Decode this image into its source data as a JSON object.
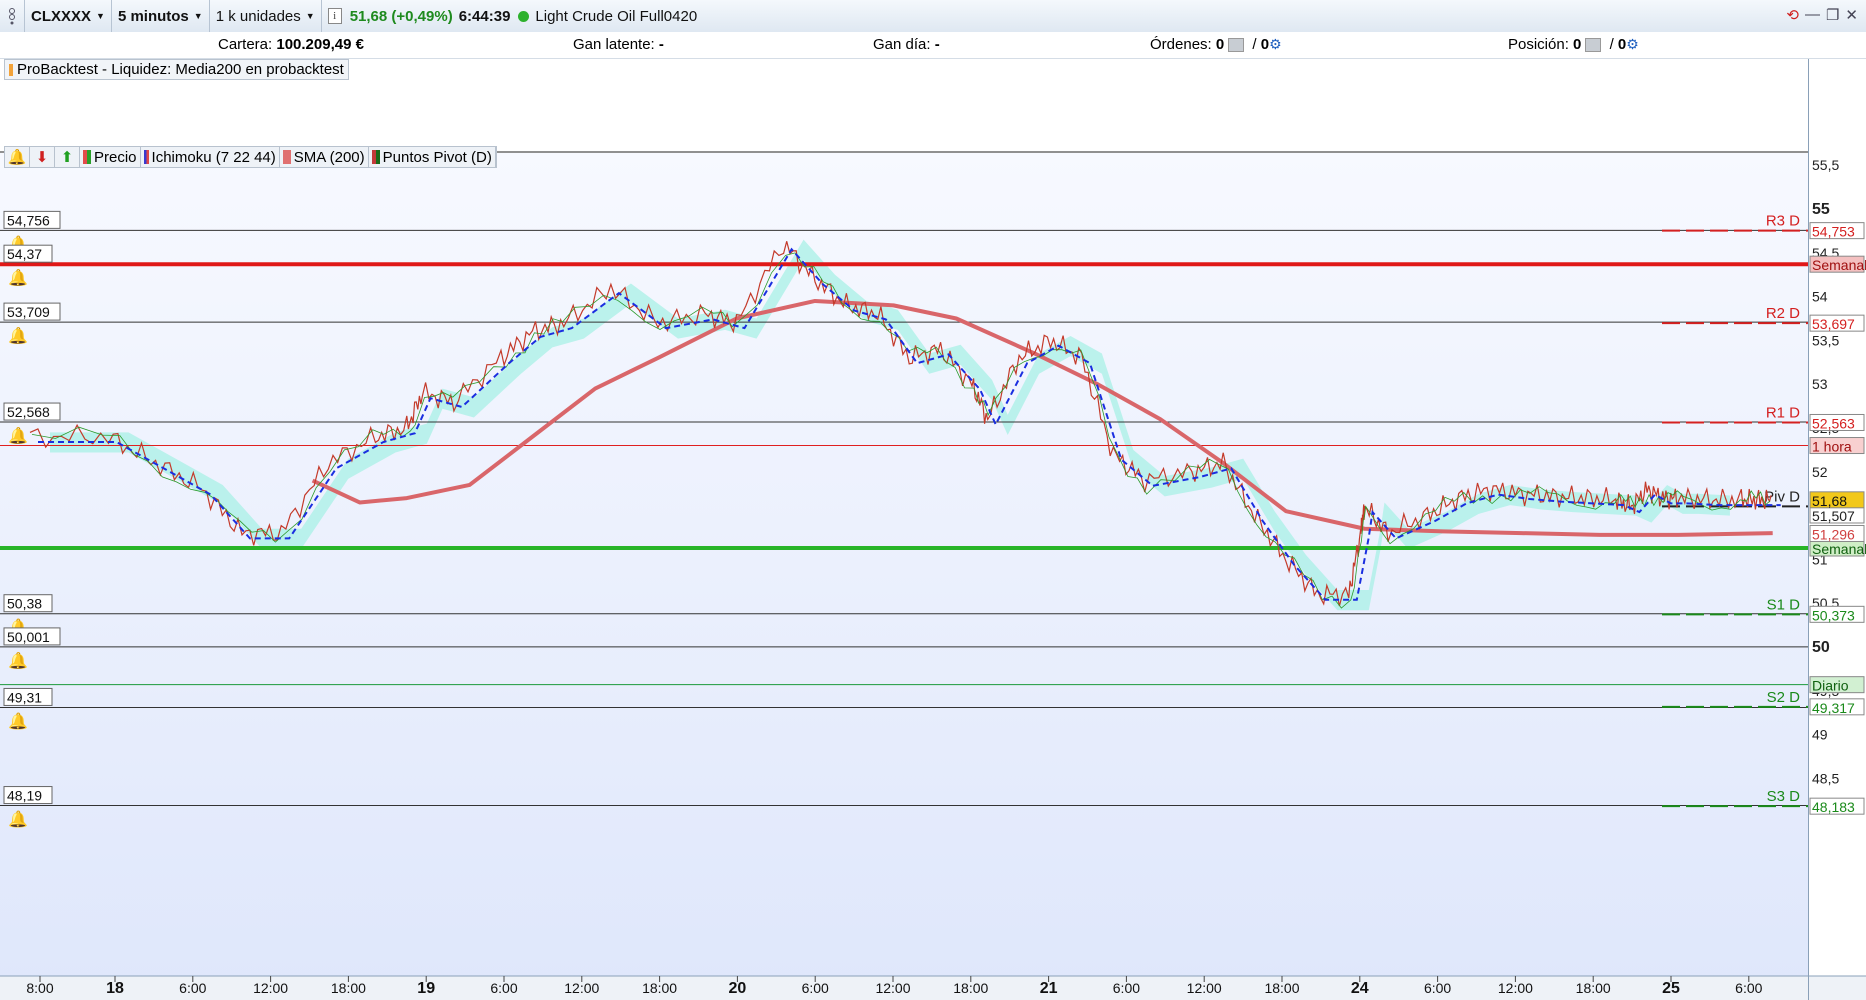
{
  "toolbar": {
    "symbol": "CLXXXX",
    "timeframe": "5 minutos",
    "units": "1 k unidades",
    "info_icon": "i",
    "price_change": "51,68 (+0,49%)",
    "time": "6:44:39",
    "instrument": "Light Crude Oil Full0420",
    "window_controls": [
      "refresh-icon",
      "minimize-icon",
      "restore-icon",
      "close-icon"
    ]
  },
  "portfolio": {
    "cartera_label": "Cartera:",
    "cartera_value": "100.209,49 €",
    "gan_latente_label": "Gan latente:",
    "gan_latente_value": "-",
    "gan_dia_label": "Gan día:",
    "gan_dia_value": "-",
    "ordenes_label": "Órdenes:",
    "ordenes_value_1": "0",
    "ordenes_sep": "/",
    "ordenes_value_2": "0",
    "posicion_label": "Posición:",
    "posicion_value_1": "0",
    "posicion_value_2": "0"
  },
  "backtest_label": "ProBacktest - Liquidez: Media200 en probacktest",
  "legend": {
    "items": [
      "Precio",
      "Ichimoku (7 22 44)",
      "SMA (200)",
      "Puntos Pivot (D)"
    ],
    "colors": [
      "#e34b4b",
      "#3a3ad0",
      "#e07070",
      "#c33a3a"
    ]
  },
  "colors": {
    "sma": "#d9666a",
    "kijun": "#1a2ee0",
    "cloud_bull": "#a8f0e6",
    "cloud_bear": "#a8f0b8",
    "weekly_high": "#e01818",
    "weekly_low": "#28b428",
    "pivot_r": "#d42020",
    "pivot_s": "#1a8a1a",
    "hourly": "#e02020",
    "daily": "#1a9a3a",
    "last_price_bg": "#f2c81a"
  },
  "chart_data": {
    "type": "line",
    "title": "",
    "xlabel": "",
    "ylabel": "",
    "ylim": [
      48.1,
      56.0
    ],
    "grid": false,
    "x_ticks": [
      "8:00",
      "18",
      "6:00",
      "12:00",
      "18:00",
      "19",
      "6:00",
      "12:00",
      "18:00",
      "20",
      "6:00",
      "12:00",
      "18:00",
      "21",
      "6:00",
      "12:00",
      "18:00",
      "24",
      "6:00",
      "12:00",
      "18:00",
      "25",
      "6:00"
    ],
    "x_ticks_bold": [
      "18",
      "19",
      "20",
      "21",
      "24",
      "25"
    ],
    "y_ticks": [
      "55,5",
      "55",
      "54,5",
      "54",
      "53,5",
      "53",
      "52,5",
      "52",
      "51,5",
      "51",
      "50,5",
      "50",
      "49,5",
      "49",
      "48,5"
    ],
    "y_ticks_values": [
      55.5,
      55,
      54.5,
      54,
      53.5,
      53,
      52.5,
      52,
      51.5,
      51,
      50.5,
      50,
      49.5,
      49,
      48.5
    ],
    "y_ticks_bold": [
      "55",
      "50"
    ],
    "pivot_levels": [
      {
        "name": "R3 D",
        "value": 54.753,
        "label": "54,753"
      },
      {
        "name": "R2 D",
        "value": 53.697,
        "label": "53,697"
      },
      {
        "name": "R1 D",
        "value": 52.563,
        "label": "52,563"
      },
      {
        "name": "Piv D",
        "value": 51.605,
        "label": "51,605"
      },
      {
        "name": "S1 D",
        "value": 50.373,
        "label": "50,373"
      },
      {
        "name": "S2 D",
        "value": 49.317,
        "label": "49,317"
      },
      {
        "name": "S3 D",
        "value": 48.183,
        "label": "48,183"
      }
    ],
    "alert_levels": [
      {
        "value": 54.756,
        "label": "54,756"
      },
      {
        "value": 54.37,
        "label": "54,37"
      },
      {
        "value": 53.709,
        "label": "53,709"
      },
      {
        "value": 52.568,
        "label": "52,568"
      },
      {
        "value": 50.38,
        "label": "50,38"
      },
      {
        "value": 50.001,
        "label": "50,001"
      },
      {
        "value": 49.31,
        "label": "49,31"
      },
      {
        "value": 48.19,
        "label": "48,19"
      }
    ],
    "period_levels": [
      {
        "name": "Semanal",
        "value": 54.37,
        "kind": "weekly_high"
      },
      {
        "name": "1 hora",
        "value": 52.3,
        "kind": "hourly"
      },
      {
        "name": "Semanal",
        "value": 51.13,
        "kind": "weekly_low"
      },
      {
        "name": "Diario",
        "value": 49.57,
        "kind": "daily"
      }
    ],
    "last_price": {
      "value": 51.68,
      "label": "51,68"
    },
    "extra_labels": [
      {
        "value": 51.507,
        "label": "51,507"
      },
      {
        "value": 51.296,
        "label": "51,296"
      }
    ],
    "series": [
      {
        "name": "Precio",
        "x": [
          0,
          1,
          1.6,
          2.2,
          2.7,
          3.2,
          3.8,
          4.4,
          4.8,
          5.0,
          5.4,
          6.0,
          6.4,
          6.8,
          7.4,
          8.0,
          8.6,
          9.0,
          9.6,
          10.0,
          10.4,
          10.8,
          11.2,
          11.6,
          12.0,
          12.2,
          12.6,
          13.0,
          13.4,
          13.8,
          14.2,
          14.8,
          15.2,
          15.6,
          16.0,
          16.4,
          16.8,
          16.95,
          17.0,
          17.3,
          17.8,
          18.2,
          18.6,
          19.0,
          19.4,
          19.8,
          20.2,
          20.4,
          20.6,
          20.8,
          21.0,
          21.4,
          21.8,
          22.0,
          22.2
        ],
        "values": [
          52.4,
          52.4,
          52.1,
          51.8,
          51.3,
          51.3,
          52.1,
          52.4,
          52.5,
          52.9,
          52.8,
          53.3,
          53.6,
          53.7,
          54.1,
          53.7,
          53.8,
          53.7,
          54.6,
          54.2,
          53.9,
          53.8,
          53.3,
          53.4,
          53.0,
          52.6,
          53.3,
          53.5,
          53.3,
          52.2,
          51.9,
          52.0,
          52.1,
          51.5,
          51.0,
          50.6,
          50.6,
          51.3,
          51.6,
          51.3,
          51.5,
          51.7,
          51.8,
          51.75,
          51.72,
          51.7,
          51.68,
          51.6,
          51.8,
          51.7,
          51.7,
          51.68,
          51.68,
          51.68,
          51.68
        ]
      },
      {
        "name": "SMA (200)",
        "x": [
          3.6,
          4.2,
          4.8,
          5.6,
          6.4,
          7.2,
          8.0,
          9.0,
          10.0,
          11.0,
          11.8,
          12.8,
          13.6,
          14.4,
          15.2,
          16.0,
          17.0,
          18.0,
          19.0,
          20.0,
          21.0,
          22.2
        ],
        "values": [
          51.9,
          51.65,
          51.7,
          51.85,
          52.4,
          52.95,
          53.3,
          53.75,
          53.95,
          53.9,
          53.75,
          53.35,
          53.0,
          52.6,
          52.1,
          51.55,
          51.35,
          51.32,
          51.3,
          51.28,
          51.28,
          51.3
        ]
      }
    ]
  }
}
